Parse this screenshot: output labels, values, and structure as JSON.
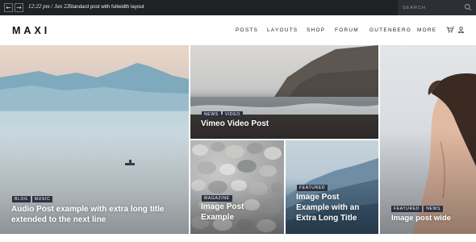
{
  "topbar": {
    "prev_arrow": "←",
    "next_arrow": "→",
    "time": "12:22 pm / Jan 22",
    "ticker": "Standard post with fullwidth layout",
    "search_placeholder": "SEARCH"
  },
  "header": {
    "logo": "MAXI",
    "nav": [
      "POSTS",
      "LAYOUTS",
      "SHOP",
      "FORUM",
      "GUTENBERG",
      "MORE"
    ],
    "cart_count": "0"
  },
  "posts": [
    {
      "tags": [
        "BLOG",
        "MUSIC"
      ],
      "title_lines": [
        "Audio Post example with extra long title",
        "extended to the next line"
      ]
    },
    {
      "tags": [
        "NEWS",
        "VIDEO"
      ],
      "title_lines": [
        "Vimeo Video Post"
      ]
    },
    {
      "tags": [
        "MAGAZINE"
      ],
      "title_lines": [
        "Image Post",
        "Example"
      ]
    },
    {
      "tags": [
        "FEATURED"
      ],
      "title_lines": [
        "Image Post",
        "Example with an",
        "Extra Long Title"
      ]
    },
    {
      "tags": [
        "FEATURED",
        "NEWS"
      ],
      "title_lines": [
        "Image post wide"
      ]
    }
  ],
  "colors": {
    "topbar": "#1f2124",
    "tag_bg": "#2d3140"
  }
}
